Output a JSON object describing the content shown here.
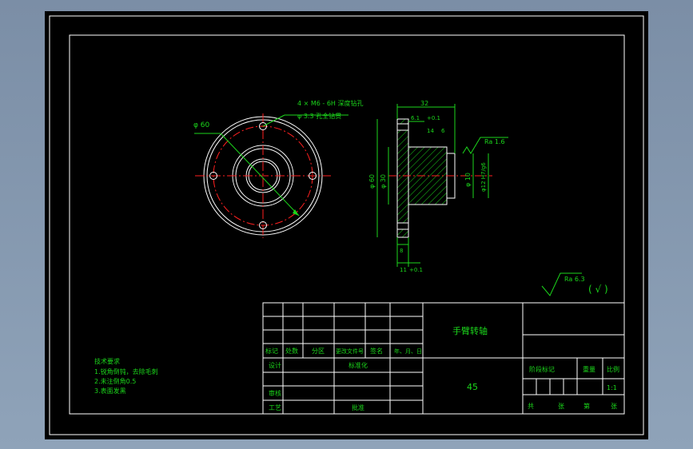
{
  "colors": {
    "background": "#000000",
    "frame": "#ffffff",
    "dimension": "#1bd61b",
    "centerline": "#ff2020",
    "outline": "#ffffff",
    "hatch": "#1bd61b",
    "desktop": "#8499b1"
  },
  "annotations": {
    "diameter_60": "φ 60",
    "holes_line1": "4 × M6 - 6H 深度钻孔",
    "holes_line2": "φ 3.3 孔全钻贯",
    "dim_width_top": "32",
    "dim_small_1": "6.1",
    "dim_small_2": "+0.1",
    "dim_small_3": "14",
    "dim_small_4": "6",
    "roughness_right": "Ra 1.6",
    "dia_left_1": "φ 60",
    "dia_left_2": "φ 30",
    "dia_right": "φ 10",
    "fit_note": "φ12 H7/g6",
    "dim_bottom_1": "8",
    "dim_bottom_2": "11",
    "dim_bottom_3": "+0.1",
    "roughness_general": "Ra 6.3",
    "roughness_paren": "( √ )"
  },
  "title_block": {
    "part_name": "手臂转轴",
    "material": "45",
    "header_row": [
      "标记",
      "处数",
      "分区",
      "更改文件号",
      "签名",
      "年、月、日"
    ],
    "design_label": "设计",
    "standard_label": "标准化",
    "review_label": "审核",
    "process_label": "工艺",
    "approve_label": "批准",
    "stage_label": "阶段标记",
    "weight_label": "重量",
    "scale_label": "比例",
    "scale_value": "1:1",
    "sheets_label": "共",
    "sheets_of_1": "张",
    "sheets_page": "第",
    "sheets_of_2": "张"
  },
  "tech_notes": {
    "title": "技术要求",
    "lines": [
      "1.锐角倒钝，去除毛刺",
      "2.未注倒角0.5",
      "3.表面发黑"
    ]
  }
}
